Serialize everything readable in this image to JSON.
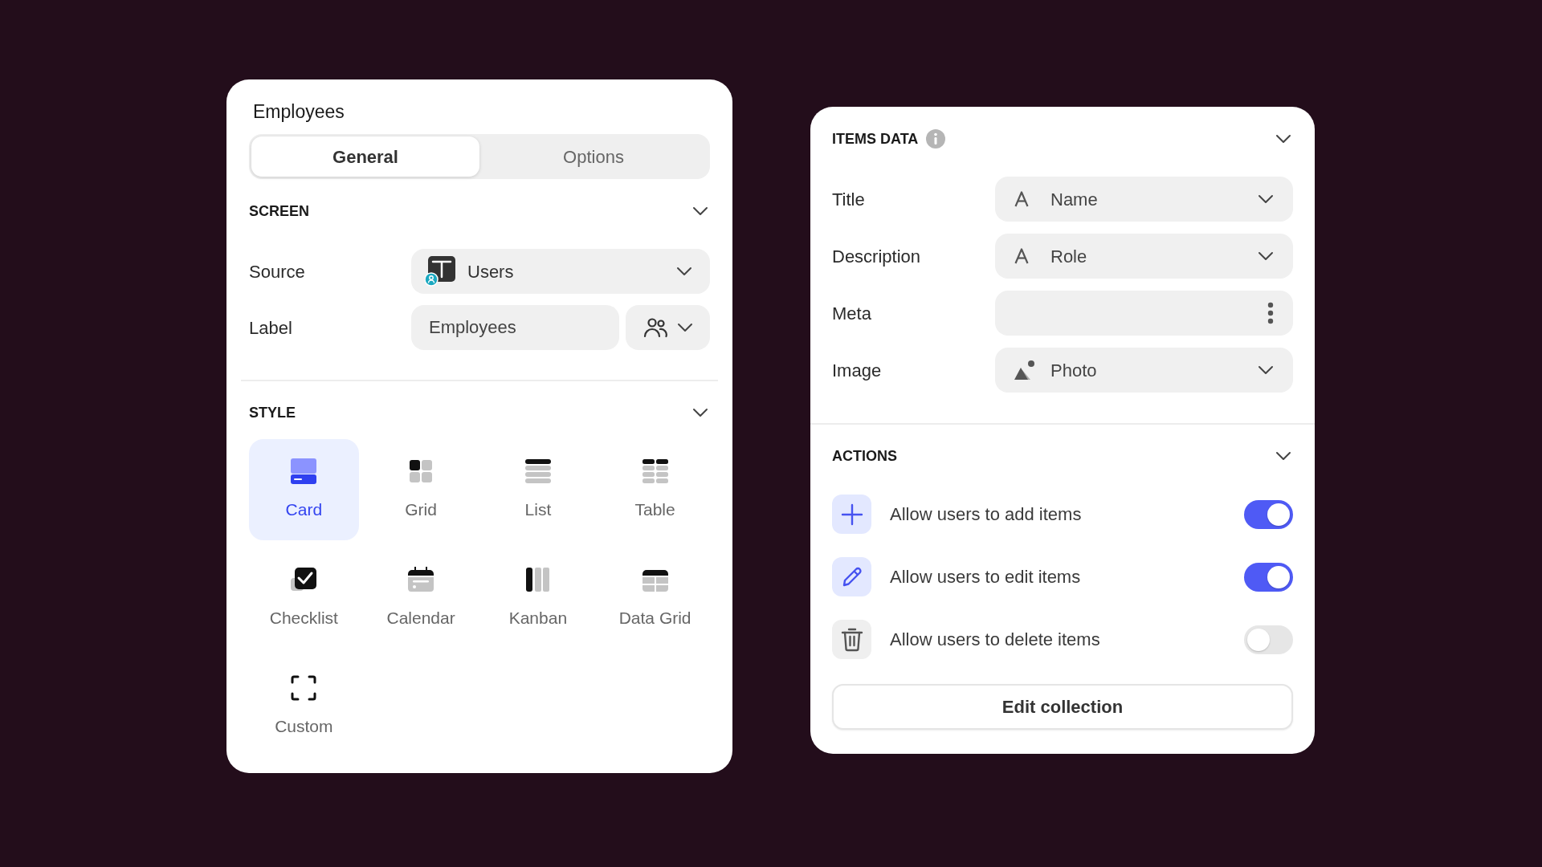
{
  "left_panel": {
    "title": "Employees",
    "tabs": [
      {
        "label": "General",
        "selected": true
      },
      {
        "label": "Options",
        "selected": false
      }
    ],
    "screen_section": {
      "heading": "SCREEN",
      "source": {
        "label": "Source",
        "value": "Users"
      },
      "label_field": {
        "label": "Label",
        "value": "Employees"
      }
    },
    "style_section": {
      "heading": "STYLE",
      "options": [
        {
          "kind": "card",
          "label": "Card",
          "selected": true
        },
        {
          "kind": "grid",
          "label": "Grid",
          "selected": false
        },
        {
          "kind": "list",
          "label": "List",
          "selected": false
        },
        {
          "kind": "table",
          "label": "Table",
          "selected": false
        },
        {
          "kind": "checklist",
          "label": "Checklist",
          "selected": false
        },
        {
          "kind": "calendar",
          "label": "Calendar",
          "selected": false
        },
        {
          "kind": "kanban",
          "label": "Kanban",
          "selected": false
        },
        {
          "kind": "data_grid",
          "label": "Data Grid",
          "selected": false
        },
        {
          "kind": "custom",
          "label": "Custom",
          "selected": false
        }
      ]
    }
  },
  "right_panel": {
    "items_data": {
      "heading": "ITEMS DATA",
      "rows": [
        {
          "kind": "text",
          "label": "Title",
          "value": "Name"
        },
        {
          "kind": "text",
          "label": "Description",
          "value": "Role"
        },
        {
          "kind": "menu",
          "label": "Meta"
        },
        {
          "kind": "image",
          "label": "Image",
          "value": "Photo"
        }
      ]
    },
    "actions": {
      "heading": "ACTIONS",
      "items": [
        {
          "kind": "add",
          "label": "Allow users to add items",
          "on": true
        },
        {
          "kind": "edit",
          "label": "Allow users to edit items",
          "on": true
        },
        {
          "kind": "delete",
          "label": "Allow users to delete items",
          "on": false
        }
      ]
    },
    "button": "Edit collection"
  }
}
